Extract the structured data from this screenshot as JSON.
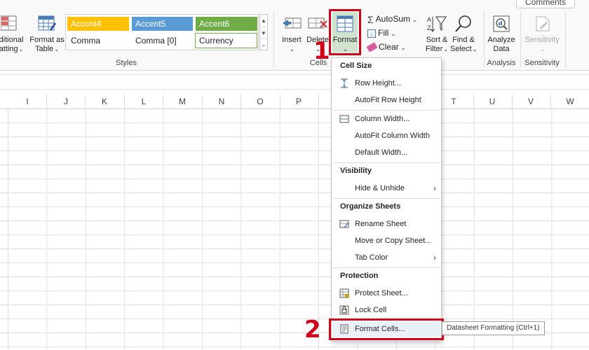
{
  "ribbon": {
    "comments_label": "Comments",
    "styles": {
      "conditional_formatting_label_line1": "ditional",
      "conditional_formatting_label_line2": "atting",
      "format_as_table_line1": "Format as",
      "format_as_table_line2": "Table",
      "group_label": "Styles",
      "cells": [
        {
          "label": "Accent4",
          "bg": "#ffc000",
          "fg": "#ffffff"
        },
        {
          "label": "Accent5",
          "bg": "#5b9bd5",
          "fg": "#ffffff"
        },
        {
          "label": "Accent6",
          "bg": "#70ad47",
          "fg": "#ffffff"
        },
        {
          "label": "Comma",
          "bg": "#ffffff",
          "fg": "#252423"
        },
        {
          "label": "Comma [0]",
          "bg": "#ffffff",
          "fg": "#252423"
        },
        {
          "label": "Currency",
          "bg": "#ffffff",
          "fg": "#252423"
        }
      ]
    },
    "cells_group": {
      "insert_label": "Insert",
      "delete_label": "Delete",
      "format_label": "Format",
      "group_label": "Cells"
    },
    "editing": {
      "autosum_label": "AutoSum",
      "fill_label": "Fill",
      "clear_label": "Clear",
      "sort_filter_line1": "Sort &",
      "sort_filter_line2": "Filter",
      "find_select_line1": "Find &",
      "find_select_line2": "Select"
    },
    "analysis": {
      "analyze_data_line1": "Analyze",
      "analyze_data_line2": "Data",
      "group_label": "Analysis"
    },
    "sensitivity": {
      "button_label": "Sensitivity",
      "group_label": "Sensitivity"
    }
  },
  "columns": [
    "I",
    "J",
    "K",
    "L",
    "M",
    "N",
    "O",
    "P",
    "T",
    "U",
    "V",
    "W"
  ],
  "menu": {
    "sections": [
      {
        "heading": "Cell Size",
        "items": [
          {
            "label": "Row Height...",
            "icon": "row-height-icon"
          },
          {
            "label": "AutoFit Row Height",
            "icon": ""
          },
          {
            "label": "Column Width...",
            "icon": "column-width-icon"
          },
          {
            "label": "AutoFit Column Width",
            "icon": ""
          },
          {
            "label": "Default Width...",
            "icon": ""
          }
        ]
      },
      {
        "heading": "Visibility",
        "items": [
          {
            "label": "Hide & Unhide",
            "icon": "",
            "submenu": true
          }
        ]
      },
      {
        "heading": "Organize Sheets",
        "items": [
          {
            "label": "Rename Sheet",
            "icon": "rename-sheet-icon"
          },
          {
            "label": "Move or Copy Sheet...",
            "icon": ""
          },
          {
            "label": "Tab Color",
            "icon": "",
            "submenu": true
          }
        ]
      },
      {
        "heading": "Protection",
        "items": [
          {
            "label": "Protect Sheet...",
            "icon": "protect-sheet-icon"
          },
          {
            "label": "Lock Cell",
            "icon": "lock-icon"
          },
          {
            "label": "Format Cells...",
            "icon": "format-cells-icon",
            "highlighted": true
          }
        ]
      }
    ]
  },
  "tooltip": "Datasheet Formatting (Ctrl+1)",
  "annotations": {
    "step1": "1",
    "step2": "2",
    "color": "#d0021b"
  }
}
